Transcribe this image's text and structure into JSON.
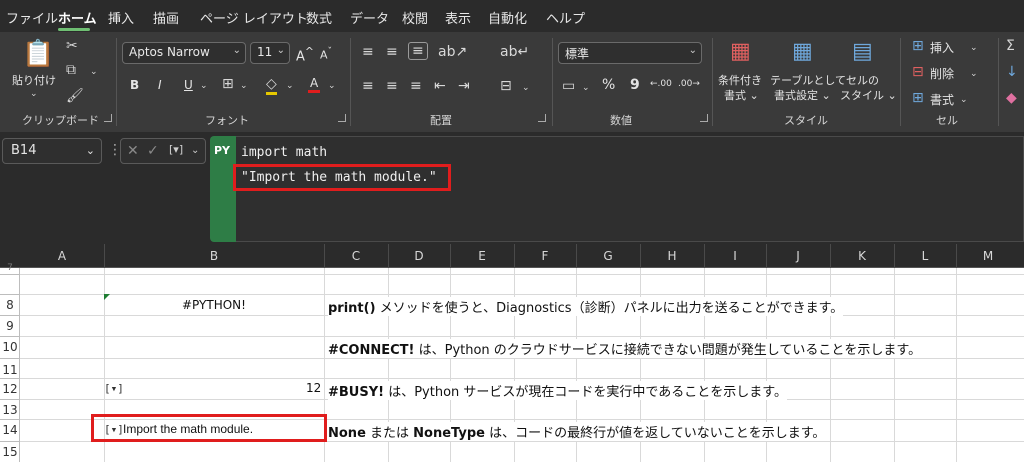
{
  "tabs": [
    "ファイル",
    "ホーム",
    "挿入",
    "描画",
    "ページ レイアウト",
    "数式",
    "データ",
    "校閲",
    "表示",
    "自動化",
    "ヘルプ"
  ],
  "ribbon": {
    "clipboard": {
      "paste_label": "貼り付け",
      "group": "クリップボード"
    },
    "font": {
      "name": "Aptos Narrow",
      "size": "11",
      "grow": "A",
      "shrink": "A",
      "bold": "B",
      "italic": "I",
      "underline": "U",
      "font_color": "A",
      "group": "フォント"
    },
    "alignment": {
      "group": "配置"
    },
    "number": {
      "format": "標準",
      "percent": "%",
      "comma": "9",
      "inc_decimal": "←.00",
      "dec_decimal": ".00→",
      "group": "数値"
    },
    "styles": {
      "conditional": "条件付き",
      "conditional2": "書式",
      "table": "テーブルとして",
      "table2": "書式設定",
      "cell": "セルの",
      "cell2": "スタイル",
      "group": "スタイル"
    },
    "cells": {
      "insert": "挿入",
      "delete": "削除",
      "format": "書式",
      "group": "セル"
    }
  },
  "formula_bar": {
    "name_box": "B14",
    "py_badge": "PY",
    "line1": "import math",
    "line2": "\"Import the math module.\""
  },
  "columns": [
    "A",
    "B",
    "C",
    "D",
    "E",
    "F",
    "G",
    "H",
    "I",
    "J",
    "K",
    "L",
    "M"
  ],
  "rows": [
    "8",
    "9",
    "10",
    "11",
    "12",
    "13",
    "14",
    "15"
  ],
  "cells": {
    "b8": "#PYTHON!",
    "c8_bold": "print()",
    "c8_rest": " メソッドを使うと、Diagnostics（診断）パネルに出力を送ることができます。",
    "c10_bold": "#CONNECT!",
    "c10_rest": " は、Python のクラウドサービスに接続できない問題が発生していることを示します。",
    "b12_icon": "[▾]",
    "b12_value": "12",
    "c12_bold": "#BUSY!",
    "c12_rest": " は、Python サービスが現在コードを実行中であることを示します。",
    "b14_icon": "[▾]",
    "b14_value": "Import the math module.",
    "c14_bold1": "None",
    "c14_mid": " または ",
    "c14_bold2": "NoneType",
    "c14_rest": " は、コードの最終行が値を返していないことを示します。"
  },
  "colors": {
    "highlight": "#e01d1d",
    "python_green": "#2e7d46",
    "ribbon_bg": "#3a3a3a"
  }
}
